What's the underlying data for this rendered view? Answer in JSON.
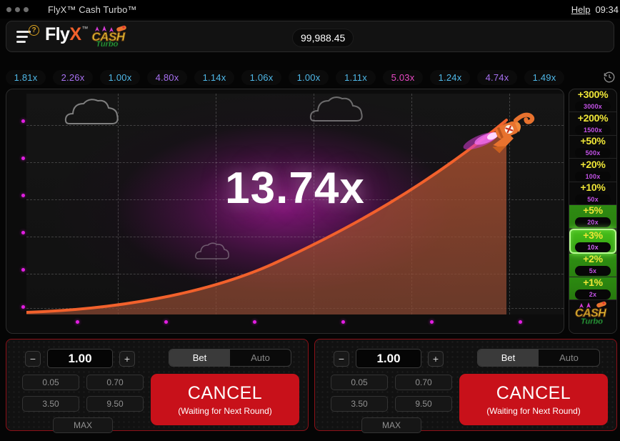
{
  "titlebar": {
    "window_title": "FlyX™ Cash Turbo™",
    "help_label": "Help",
    "clock": "09:34",
    "dots_icon": "window-dots-icon"
  },
  "header": {
    "menu_icon": "hamburger-menu-icon",
    "help_badge": "?",
    "logo_fly": "Fly",
    "logo_x": "X",
    "logo_tm": "™",
    "logo_cash": "CASH",
    "logo_turbo": "Turbo",
    "balance": "99,988.45"
  },
  "history": {
    "clock_icon": "history-clock-icon",
    "chips": [
      {
        "value": "1.81x",
        "tone": "blue"
      },
      {
        "value": "2.26x",
        "tone": "purple"
      },
      {
        "value": "1.00x",
        "tone": "blue"
      },
      {
        "value": "4.80x",
        "tone": "purple"
      },
      {
        "value": "1.14x",
        "tone": "blue"
      },
      {
        "value": "1.06x",
        "tone": "blue"
      },
      {
        "value": "1.00x",
        "tone": "blue"
      },
      {
        "value": "1.11x",
        "tone": "blue"
      },
      {
        "value": "5.03x",
        "tone": "pink"
      },
      {
        "value": "1.24x",
        "tone": "blue"
      },
      {
        "value": "4.74x",
        "tone": "purple"
      },
      {
        "value": "1.49x",
        "tone": "blue"
      }
    ]
  },
  "game": {
    "multiplier": "13.74x",
    "rocket_icon": "rocket-character-icon",
    "cloud_icon": "cloud-icon",
    "curve_color": "#f2612c",
    "glow_color": "#96198c",
    "axis_dot_color": "#e21ee2"
  },
  "chart_data": {
    "type": "area",
    "title": "13.74x",
    "xlabel": "",
    "ylabel": "",
    "x": [
      0,
      0.1,
      0.2,
      0.3,
      0.4,
      0.5,
      0.6,
      0.7,
      0.8,
      0.9,
      1.0
    ],
    "y": [
      1.0,
      1.18,
      1.45,
      1.85,
      2.4,
      3.2,
      4.3,
      5.9,
      8.1,
      10.8,
      13.74
    ],
    "series": [
      {
        "name": "multiplier",
        "values": [
          1.0,
          1.18,
          1.45,
          1.85,
          2.4,
          3.2,
          4.3,
          5.9,
          8.1,
          10.8,
          13.74
        ]
      }
    ],
    "xlim": [
      0,
      1.0
    ],
    "ylim": [
      1.0,
      14.5
    ],
    "grid": true,
    "legend": "none",
    "line_color": "#f2612c",
    "fill_color": "rgba(180,70,40,0.55)",
    "annotations": [
      "13.74x"
    ]
  },
  "ladder": {
    "logo_cash": "CASH",
    "logo_turbo": "Turbo",
    "rungs": [
      {
        "pct": "+300%",
        "mult": "3000x",
        "state": "dark"
      },
      {
        "pct": "+200%",
        "mult": "1500x",
        "state": "dark"
      },
      {
        "pct": "+50%",
        "mult": "500x",
        "state": "dark"
      },
      {
        "pct": "+20%",
        "mult": "100x",
        "state": "dark"
      },
      {
        "pct": "+10%",
        "mult": "50x",
        "state": "dark"
      },
      {
        "pct": "+5%",
        "mult": "20x",
        "state": "green1"
      },
      {
        "pct": "+3%",
        "mult": "10x",
        "state": "active"
      },
      {
        "pct": "+2%",
        "mult": "5x",
        "state": "green2"
      },
      {
        "pct": "+1%",
        "mult": "2x",
        "state": "green3"
      }
    ]
  },
  "bets": [
    {
      "minus_label": "−",
      "plus_label": "+",
      "amount": "1.00",
      "tab_bet": "Bet",
      "tab_auto": "Auto",
      "active_tab": "Bet",
      "quick": [
        "0.05",
        "0.70",
        "3.50",
        "9.50"
      ],
      "max_label": "MAX",
      "action_label": "CANCEL",
      "action_sub": "(Waiting for Next Round)"
    },
    {
      "minus_label": "−",
      "plus_label": "+",
      "amount": "1.00",
      "tab_bet": "Bet",
      "tab_auto": "Auto",
      "active_tab": "Bet",
      "quick": [
        "0.05",
        "0.70",
        "3.50",
        "9.50"
      ],
      "max_label": "MAX",
      "action_label": "CANCEL",
      "action_sub": "(Waiting for Next Round)"
    }
  ]
}
